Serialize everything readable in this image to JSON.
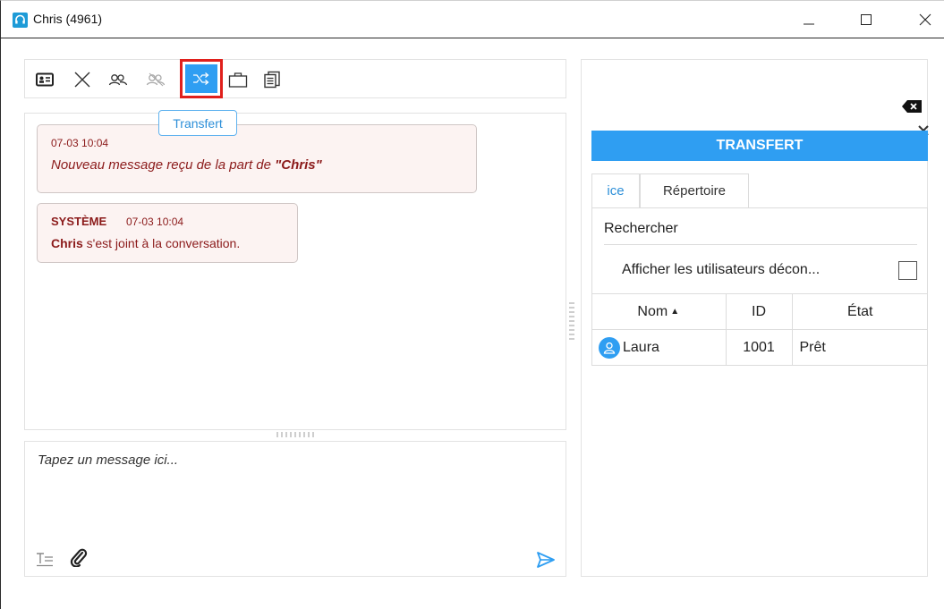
{
  "window": {
    "title": "Chris (4961)"
  },
  "toolbar": {
    "tooltip": "Transfert"
  },
  "chat": {
    "messages": [
      {
        "timestamp": "07-03 10:04",
        "text_prefix": "Nouveau message reçu de la part de ",
        "sender": "\"Chris\""
      },
      {
        "label": "SYSTÈME",
        "timestamp": "07-03 10:04",
        "name": "Chris",
        "text": " s'est joint à la conversation."
      }
    ]
  },
  "input": {
    "placeholder": "Tapez un message ici..."
  },
  "panel": {
    "header": "TRANSFERT",
    "tabs": [
      {
        "label": "ice"
      },
      {
        "label": "Répertoire"
      }
    ],
    "search_label": "Rechercher",
    "show_disconnected_label": "Afficher les utilisateurs décon...",
    "show_disconnected_checked": false,
    "table": {
      "columns": [
        "Nom",
        "ID",
        "État"
      ],
      "rows": [
        {
          "name": "Laura",
          "id": "1001",
          "state": "Prêt"
        }
      ]
    }
  },
  "colors": {
    "accent": "#2f9ef2",
    "highlight": "#e0201c",
    "message_text": "#8b1a1a"
  }
}
